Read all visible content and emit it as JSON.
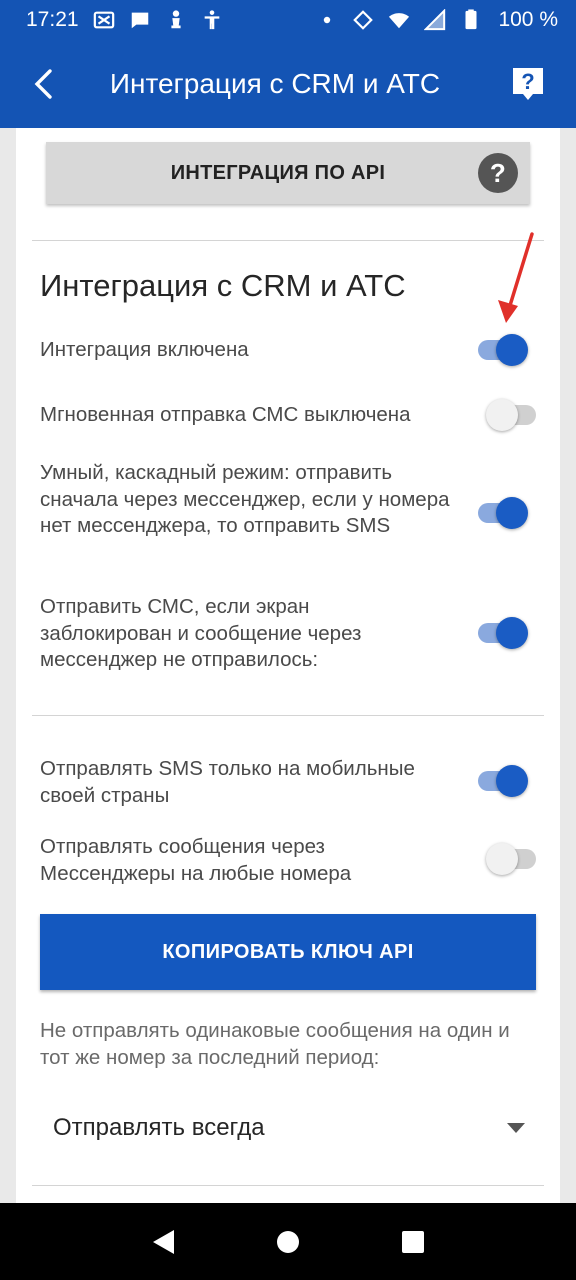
{
  "status_bar": {
    "time": "17:21",
    "battery": "100 %"
  },
  "app_bar": {
    "title": "Интеграция с CRM и АТС",
    "back_icon": "back-arrow-icon",
    "help_icon": "help-icon"
  },
  "api_button": {
    "label": "ИНТЕГРАЦИЯ ПО API",
    "help_glyph": "?"
  },
  "section": {
    "title": "Интеграция с CRM и АТС",
    "settings": [
      {
        "label": "Интеграция включена",
        "enabled": true
      },
      {
        "label": "Мгновенная отправка СМС выключена",
        "enabled": false
      },
      {
        "label": "Умный, каскадный режим: отправить сначала через мессенджер, если у номера нет мессенджера, то отправить SMS",
        "enabled": true
      },
      {
        "label": "Отправить СМС, если экран заблокирован и сообщение через мессенджер не отправилось:",
        "enabled": true
      }
    ]
  },
  "extra_settings": [
    {
      "label": "Отправлять SMS только на мобильные своей страны",
      "enabled": true
    },
    {
      "label": "Отправлять сообщения через Мессенджеры на любые номера",
      "enabled": false
    }
  ],
  "copy_button": {
    "label": "КОПИРОВАТЬ КЛЮЧ API"
  },
  "duplicates": {
    "label": "Не отправлять одинаковые сообщения на один и тот же номер за последний период:",
    "selected": "Отправлять всегда"
  },
  "colors": {
    "primary": "#1454b4",
    "toggle_on": "#1a5cc4",
    "annotation_arrow": "#e0302a"
  }
}
